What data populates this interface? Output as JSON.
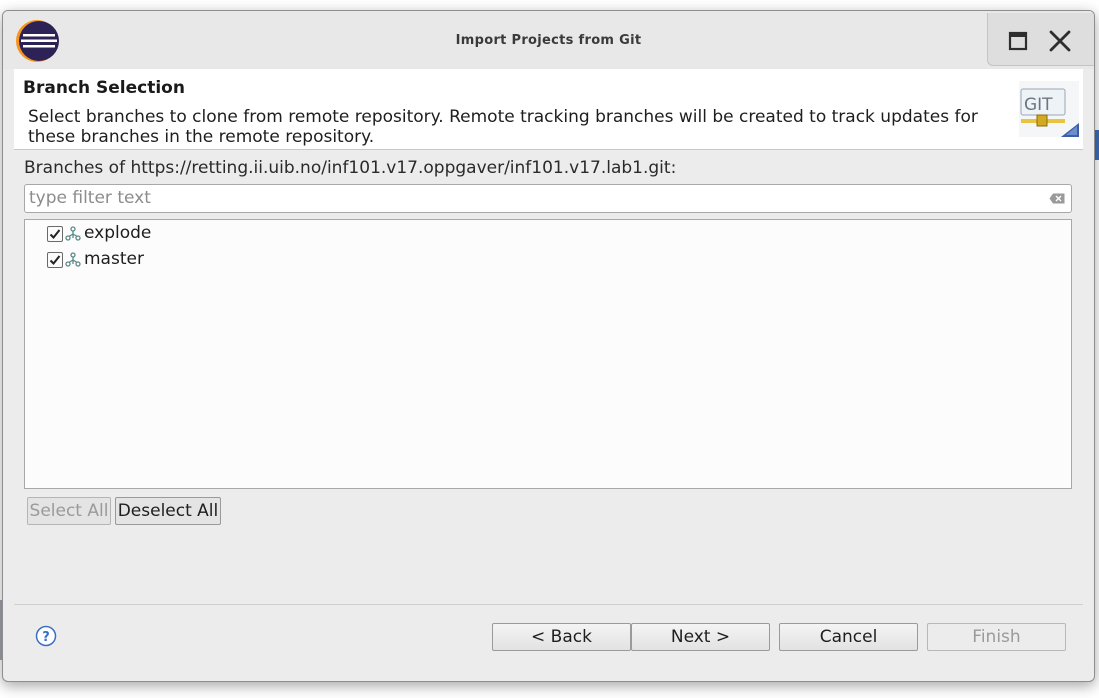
{
  "window": {
    "title": "Import Projects from Git"
  },
  "banner": {
    "title": "Branch Selection",
    "description": "Select branches to clone from remote repository. Remote tracking branches will be created to track updates for these branches in the remote repository.",
    "logo_text": "GIT"
  },
  "branches_label": "Branches of https://retting.ii.uib.no/inf101.v17.oppgaver/inf101.v17.lab1.git:",
  "filter": {
    "placeholder": "type filter text",
    "value": ""
  },
  "branches": [
    {
      "name": "explode",
      "checked": true
    },
    {
      "name": "master",
      "checked": true
    }
  ],
  "select_buttons": {
    "select_all": "Select All",
    "deselect_all": "Deselect All"
  },
  "footer": {
    "back": "< Back",
    "next": "Next >",
    "cancel": "Cancel",
    "finish": "Finish"
  },
  "colors": {
    "dialog_bg": "#ececec",
    "banner_bg": "#ffffff",
    "disabled_text": "#9a9a9a",
    "help_icon": "#3b6fc4"
  }
}
